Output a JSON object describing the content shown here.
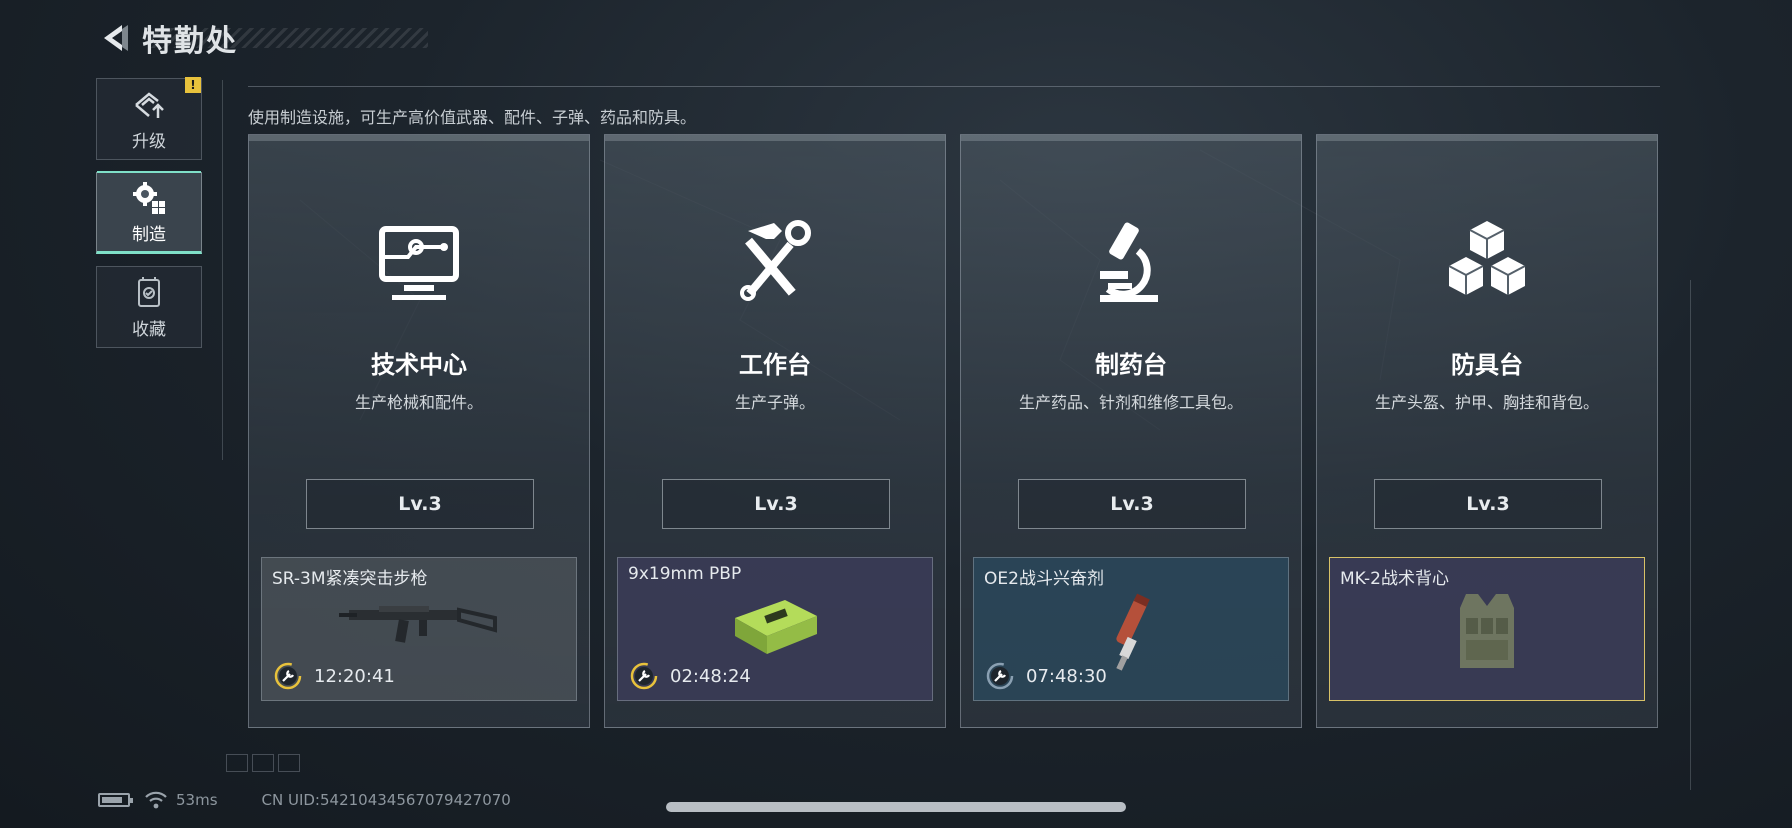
{
  "header": {
    "title": "特勤处",
    "back_icon": "back-arrow-icon"
  },
  "sidebar": {
    "items": [
      {
        "label": "升级",
        "icon": "upgrade-icon",
        "badge": "!"
      },
      {
        "label": "制造",
        "icon": "gears-icon",
        "active": true
      },
      {
        "label": "收藏",
        "icon": "collection-icon"
      }
    ]
  },
  "subtitle": "使用制造设施，可生产高价值武器、配件、子弹、药品和防具。",
  "cards": [
    {
      "title": "技术中心",
      "desc": "生产枪械和配件。",
      "level": "Lv.3",
      "icon": "computer-icon",
      "production": {
        "name": "SR-3M紧凑突击步枪",
        "timer": "12:20:41",
        "quality": "gray",
        "image": "rifle-image"
      }
    },
    {
      "title": "工作台",
      "desc": "生产子弹。",
      "level": "Lv.3",
      "icon": "hammer-wrench-icon",
      "production": {
        "name": "9x19mm PBP",
        "timer": "02:48:24",
        "quality": "purple",
        "image": "ammo-box-image"
      }
    },
    {
      "title": "制药台",
      "desc": "生产药品、针剂和维修工具包。",
      "level": "Lv.3",
      "icon": "microscope-icon",
      "production": {
        "name": "OE2战斗兴奋剂",
        "timer": "07:48:30",
        "quality": "blue",
        "image": "injector-image"
      }
    },
    {
      "title": "防具台",
      "desc": "生产头盔、护甲、胸挂和背包。",
      "level": "Lv.3",
      "icon": "cubes-icon",
      "production": {
        "name": "MK-2战术背心",
        "timer": "",
        "quality": "gold",
        "image": "vest-image"
      }
    }
  ],
  "footer": {
    "ping": "53ms",
    "uid": "CN UID:54210434567079427070"
  },
  "colors": {
    "accent": "#7fe0c8",
    "badge": "#e8c23c",
    "gold_border": "#d8c267"
  }
}
